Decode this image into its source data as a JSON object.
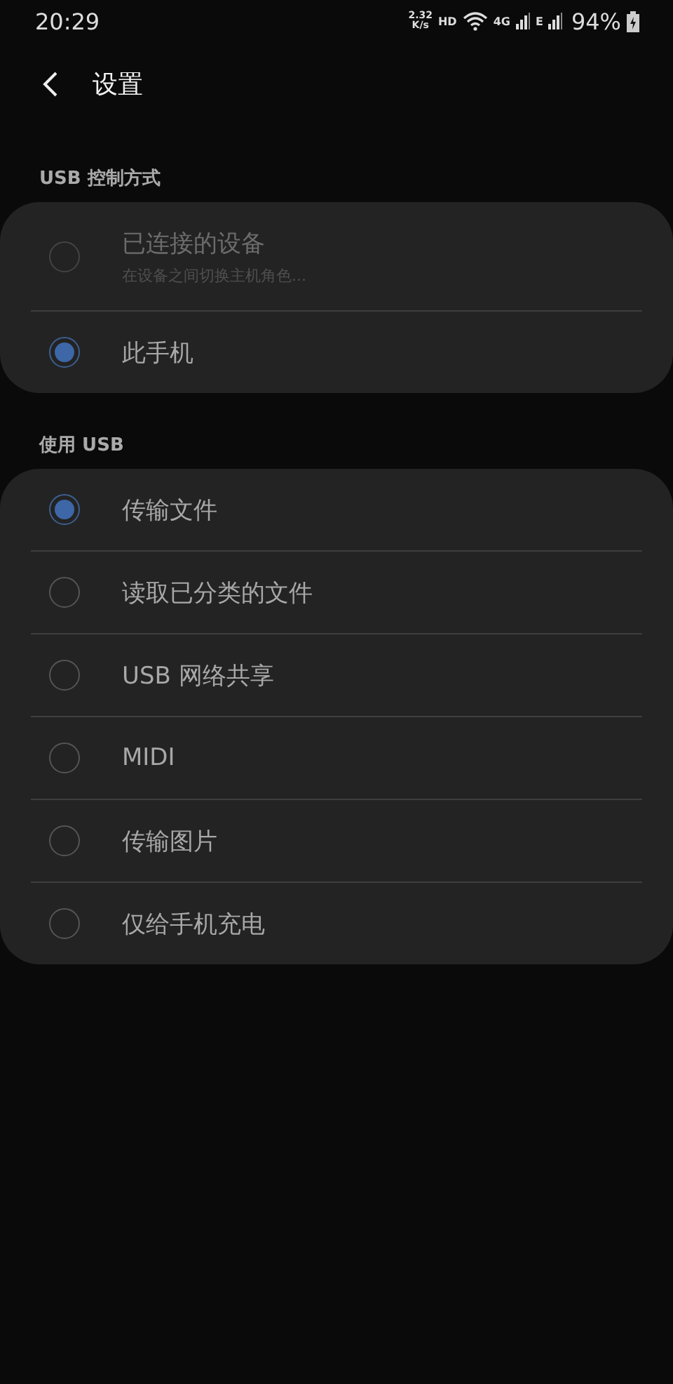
{
  "status_bar": {
    "time": "20:29",
    "speed_value": "2.32",
    "speed_unit": "K/s",
    "hd": "HD",
    "network_4g": "4G",
    "network_e": "E",
    "battery": "94%"
  },
  "header": {
    "back": true,
    "title": "设置"
  },
  "sections": [
    {
      "title": "USB 控制方式",
      "options": [
        {
          "label": "已连接的设备",
          "sublabel": "在设备之间切换主机角色...",
          "selected": false,
          "disabled": true
        },
        {
          "label": "此手机",
          "selected": true,
          "disabled": false
        }
      ]
    },
    {
      "title": "使用 USB",
      "options": [
        {
          "label": "传输文件",
          "selected": true,
          "disabled": false
        },
        {
          "label": "读取已分类的文件",
          "selected": false,
          "disabled": false
        },
        {
          "label": "USB 网络共享",
          "selected": false,
          "disabled": false
        },
        {
          "label": "MIDI",
          "selected": false,
          "disabled": false
        },
        {
          "label": "传输图片",
          "selected": false,
          "disabled": false
        },
        {
          "label": "仅给手机充电",
          "selected": false,
          "disabled": false
        }
      ]
    }
  ]
}
